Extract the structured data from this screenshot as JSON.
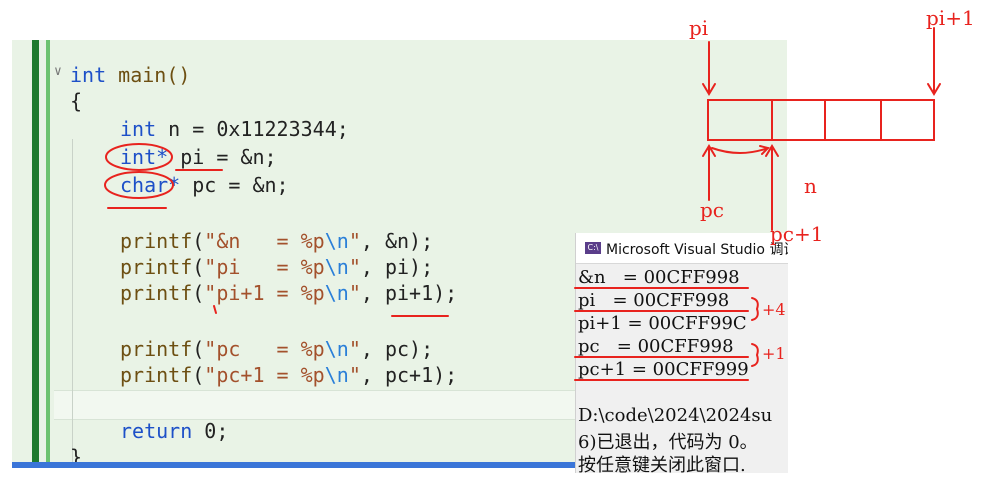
{
  "editor": {
    "lines": [
      {
        "kind": "func",
        "type": "int",
        "name": "main()"
      },
      {
        "kind": "plain",
        "text": "{"
      },
      {
        "kind": "decl",
        "type": "int",
        "rest": " n = 0x11223344;"
      },
      {
        "kind": "decl",
        "type": "int*",
        "rest": " pi = &n;"
      },
      {
        "kind": "decl",
        "type": "char*",
        "rest": " pc = &n;"
      },
      {
        "kind": "printf",
        "fn": "printf",
        "fmt": "\"&n   = %p",
        "esc": "\\n",
        "end": "\"",
        "args": ", &n);"
      },
      {
        "kind": "printf",
        "fn": "printf",
        "fmt": "\"pi   = %p",
        "esc": "\\n",
        "end": "\"",
        "args": ", pi);"
      },
      {
        "kind": "printf",
        "fn": "printf",
        "fmt": "\"pi+1 = %p",
        "esc": "\\n",
        "end": "\"",
        "args": ", pi+1);"
      },
      {
        "kind": "printf",
        "fn": "printf",
        "fmt": "\"pc   = %p",
        "esc": "\\n",
        "end": "\"",
        "args": ", pc);"
      },
      {
        "kind": "printf",
        "fn": "printf",
        "fmt": "\"pc+1 = %p",
        "esc": "\\n",
        "end": "\"",
        "args": ", pc+1);"
      },
      {
        "kind": "return",
        "kw": "return",
        "rest": " 0;"
      },
      {
        "kind": "plain",
        "text": "}"
      }
    ]
  },
  "console": {
    "title": "Microsoft Visual Studio 调试",
    "icon_label": "C:\\",
    "lines": [
      "&n   = 00CFF998",
      "pi   = 00CFF998",
      "pi+1 = 00CFF99C",
      "pc   = 00CFF998",
      "pc+1 = 00CFF999",
      "",
      "D:\\code\\2024\\2024su",
      "6)已退出，代码为 0。",
      "按任意键关闭此窗口."
    ]
  },
  "annotations": {
    "pi": "pi",
    "pi_plus_1": "pi+1",
    "pc": "pc",
    "pc_plus_1": "pc+1",
    "n": "n",
    "plus4": "+4",
    "plus1": "+1"
  },
  "colors": {
    "annotation": "#e8231e",
    "editor_bg": "#e9f3e6",
    "keyword": "#1d50c8",
    "string": "#a3512c"
  }
}
